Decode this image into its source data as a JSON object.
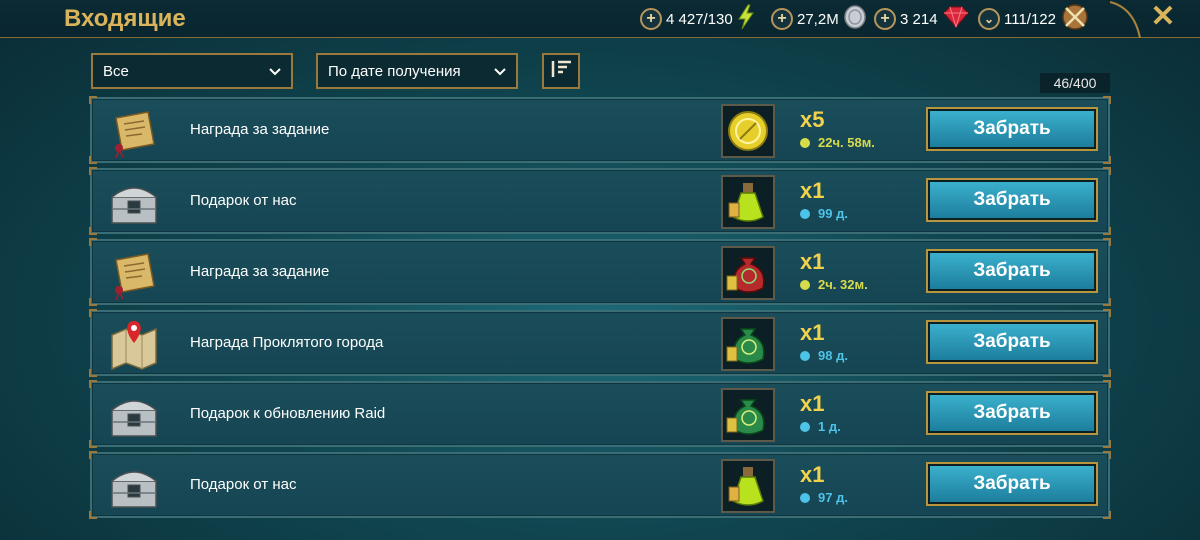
{
  "header": {
    "title": "Входящие",
    "close_icon": "close-icon"
  },
  "resources": [
    {
      "name": "energy",
      "value": "4 427/130",
      "icon": "lightning-icon"
    },
    {
      "name": "silver",
      "value": "27,2M",
      "icon": "silver-coin-icon"
    },
    {
      "name": "gems",
      "value": "3 214",
      "icon": "ruby-icon"
    },
    {
      "name": "arena",
      "value": "111/122",
      "icon": "crossed-swords-icon"
    }
  ],
  "filters": {
    "type_value": "Все",
    "sort_value": "По дате получения",
    "sort_order_icon": "sort-order-icon"
  },
  "count": "46/400",
  "claim_label": "Забрать",
  "colors": {
    "timer_yellow": "#d7dc4a",
    "timer_blue": "#4dc3e8",
    "gold": "#d9b45a",
    "button": "#2c9bbb"
  },
  "rows": [
    {
      "label": "Награда за задание",
      "icon": "scroll-icon",
      "item_icon": "gold-coin-icon",
      "qty": "x5",
      "timer": "22ч. 58м.",
      "timer_color": "#d7dc4a"
    },
    {
      "label": "Подарок от нас",
      "icon": "chest-icon",
      "item_icon": "potion-icon",
      "qty": "x1",
      "timer": "99 д.",
      "timer_color": "#4dc3e8"
    },
    {
      "label": "Награда за задание",
      "icon": "scroll-icon",
      "item_icon": "red-bag-icon",
      "qty": "x1",
      "timer": "2ч. 32м.",
      "timer_color": "#d7dc4a"
    },
    {
      "label": "Награда Проклятого города",
      "icon": "map-icon",
      "item_icon": "green-bag-icon",
      "qty": "x1",
      "timer": "98 д.",
      "timer_color": "#4dc3e8"
    },
    {
      "label": "Подарок к обновлению Raid",
      "icon": "chest-icon",
      "item_icon": "green-bag-icon",
      "qty": "x1",
      "timer": "1 д.",
      "timer_color": "#4dc3e8"
    },
    {
      "label": "Подарок от нас",
      "icon": "chest-icon",
      "item_icon": "potion-icon",
      "qty": "x1",
      "timer": "97 д.",
      "timer_color": "#4dc3e8"
    }
  ]
}
